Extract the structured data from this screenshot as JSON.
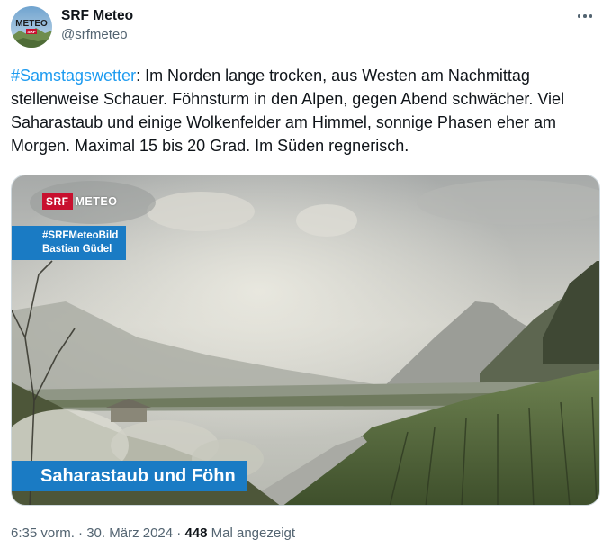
{
  "author": {
    "display_name": "SRF Meteo",
    "handle": "@srfmeteo",
    "avatar_icon": "srf-meteo-logo",
    "avatar_logo_text": "METEO",
    "avatar_logo_badge": "SRF"
  },
  "tweet": {
    "hashtag": "#Samstagswetter",
    "text": ": Im Norden lange trocken, aus Westen am Nachmittag stellenweise Schauer. Föhnsturm in den Alpen, gegen Abend schwächer. Viel Saharastaub und einige Wolkenfelder am Himmel, sonnige Phasen eher am Morgen. Maximal 15 bis 20 Grad. Im Süden regnerisch."
  },
  "media": {
    "brand_srf": "SRF",
    "brand_meteo": "METEO",
    "credit_tag": "#SRFMeteoBild",
    "credit_name": "Bastian Güdel",
    "caption": "Saharastaub und Föhn"
  },
  "meta": {
    "time": "6:35 vorm.",
    "separator": "·",
    "date": "30. März 2024",
    "separator2": "·",
    "views_count": "448",
    "views_label": "Mal angezeigt"
  },
  "colors": {
    "hashtag": "#1d9bf0",
    "srf_red": "#c8102e",
    "overlay_blue": "#1a7bc4",
    "secondary_text": "#536471"
  }
}
